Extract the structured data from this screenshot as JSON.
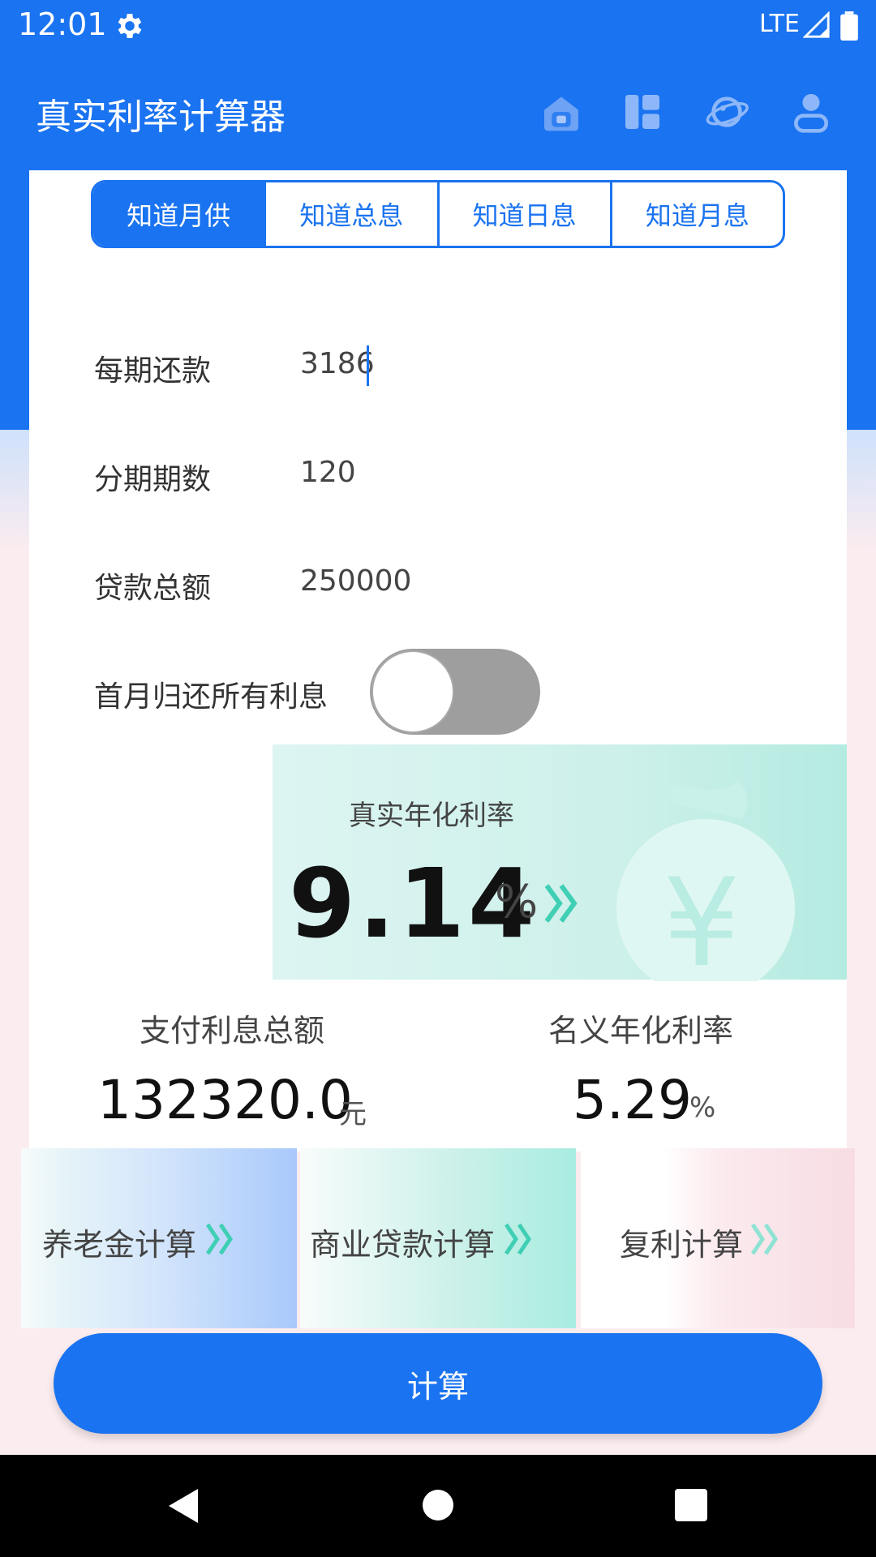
{
  "status_bar": {
    "time": "12:01",
    "network": "LTE"
  },
  "app_bar": {
    "title": "真实利率计算器",
    "icons": [
      "home-icon",
      "dashboard-icon",
      "planet-icon",
      "profile-icon"
    ]
  },
  "tabs": [
    {
      "label": "知道月供",
      "active": true
    },
    {
      "label": "知道总息",
      "active": false
    },
    {
      "label": "知道日息",
      "active": false
    },
    {
      "label": "知道月息",
      "active": false
    }
  ],
  "form": {
    "payment": {
      "label": "每期还款",
      "value": "3186"
    },
    "periods": {
      "label": "分期期数",
      "value": "120"
    },
    "loan": {
      "label": "贷款总额",
      "value": "250000"
    },
    "first_month_interest": {
      "label": "首月归还所有利息",
      "enabled": false
    }
  },
  "result": {
    "real_rate_label": "真实年化利率",
    "real_rate_value": "9.14",
    "real_rate_unit": "%",
    "total_interest_label": "支付利息总额",
    "total_interest_value": "132320.0",
    "total_interest_unit": "元",
    "nominal_rate_label": "名义年化利率",
    "nominal_rate_value": "5.29",
    "nominal_rate_unit": "%"
  },
  "shortcuts": [
    {
      "label": "养老金计算",
      "color": "#a9c9fb"
    },
    {
      "label": "商业贷款计算",
      "color": "#a8ece0"
    },
    {
      "label": "复利计算",
      "color": "#f7dde3"
    }
  ],
  "calc_button": {
    "label": "计算"
  },
  "colors": {
    "primary": "#1a73f0",
    "teal": "#3fcfb4"
  }
}
